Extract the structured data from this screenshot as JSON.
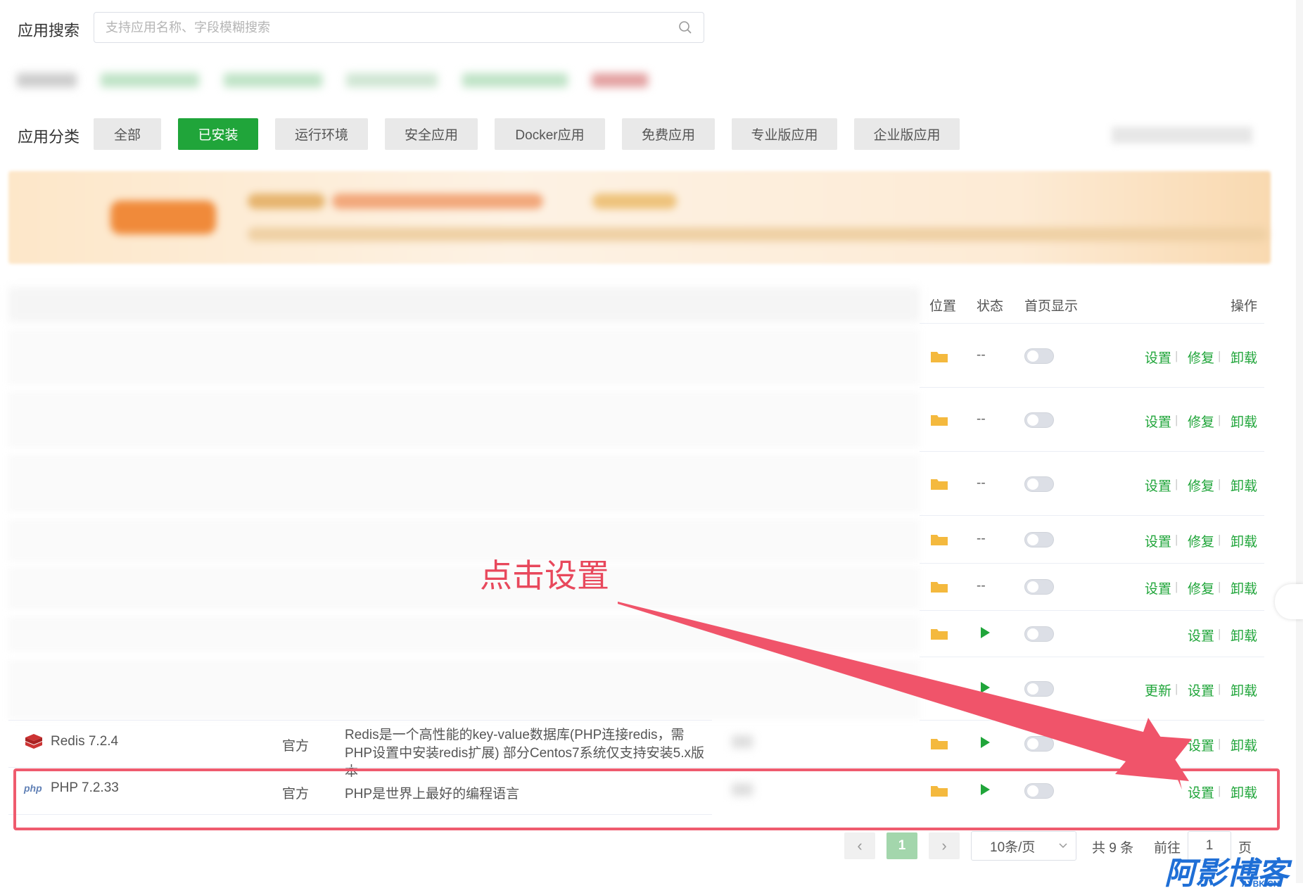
{
  "search": {
    "label": "应用搜索",
    "placeholder": "支持应用名称、字段模糊搜索"
  },
  "categories": {
    "label": "应用分类",
    "items": [
      "全部",
      "已安装",
      "运行环境",
      "安全应用",
      "Docker应用",
      "免费应用",
      "专业版应用",
      "企业版应用"
    ],
    "active": "已安装"
  },
  "table": {
    "headers": {
      "location": "位置",
      "status": "状态",
      "home_display": "首页显示",
      "actions": "操作"
    },
    "actions": {
      "settings": "设置",
      "repair": "修复",
      "uninstall": "卸载",
      "update": "更新"
    },
    "blurred_status": "--",
    "redis": {
      "name": "Redis 7.2.4",
      "type": "官方",
      "desc": "Redis是一个高性能的key-value数据库(PHP连接redis，需PHP设置中安装redis扩展) 部分Centos7系统仅支持安装5.x版本"
    },
    "php": {
      "name": "PHP 7.2.33",
      "type": "官方",
      "desc": "PHP是世界上最好的编程语言",
      "logo": "php"
    }
  },
  "annotation": "点击设置",
  "pagination": {
    "prev": "‹",
    "current": "1",
    "next": "›",
    "page_size": "10条/页",
    "total": "共 9 条",
    "goto_label": "前往",
    "goto_value": "1",
    "page_unit": "页"
  },
  "watermark": {
    "text": "阿影博客",
    "sub": "AYBK.CN"
  },
  "colors": {
    "accent": "#20a53a",
    "annotation": "#e8485c"
  }
}
